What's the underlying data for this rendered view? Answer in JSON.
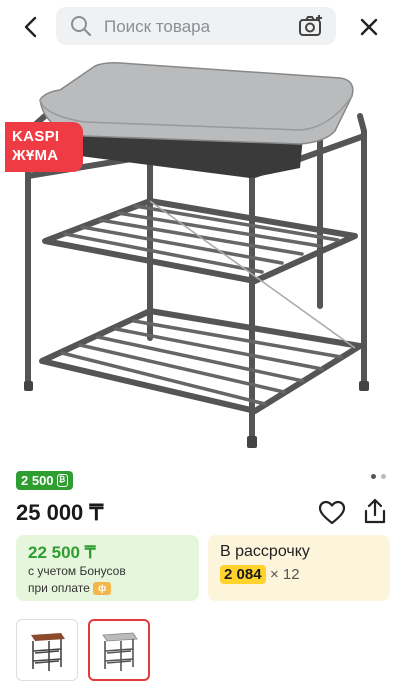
{
  "search": {
    "placeholder": "Поиск товара",
    "icons": {
      "back": "arrow-left-icon",
      "search": "search-icon",
      "camera": "camera-search-icon",
      "close": "close-icon"
    }
  },
  "promo_badge": {
    "line1": "KASPI",
    "line2": "ЖҰМА",
    "color": "#ef3c44"
  },
  "gallery": {
    "total_images": 2,
    "active_index": 1
  },
  "bonus": {
    "amount": "2 500",
    "color": "#2e9e31"
  },
  "price": "25 000 ₸",
  "actions": {
    "favorite_icon": "heart-icon",
    "share_icon": "share-icon"
  },
  "bonus_card": {
    "price": "22 500 ₸",
    "line1": "с учетом Бонусов",
    "line2": "при оплате"
  },
  "installment_card": {
    "title": "В рассрочку",
    "amount": "2 084",
    "multiplier": "× 12"
  },
  "thumbnails": [
    {
      "name": "thumbnail-brown-seat"
    },
    {
      "name": "thumbnail-grey-seat",
      "selected": true
    }
  ]
}
